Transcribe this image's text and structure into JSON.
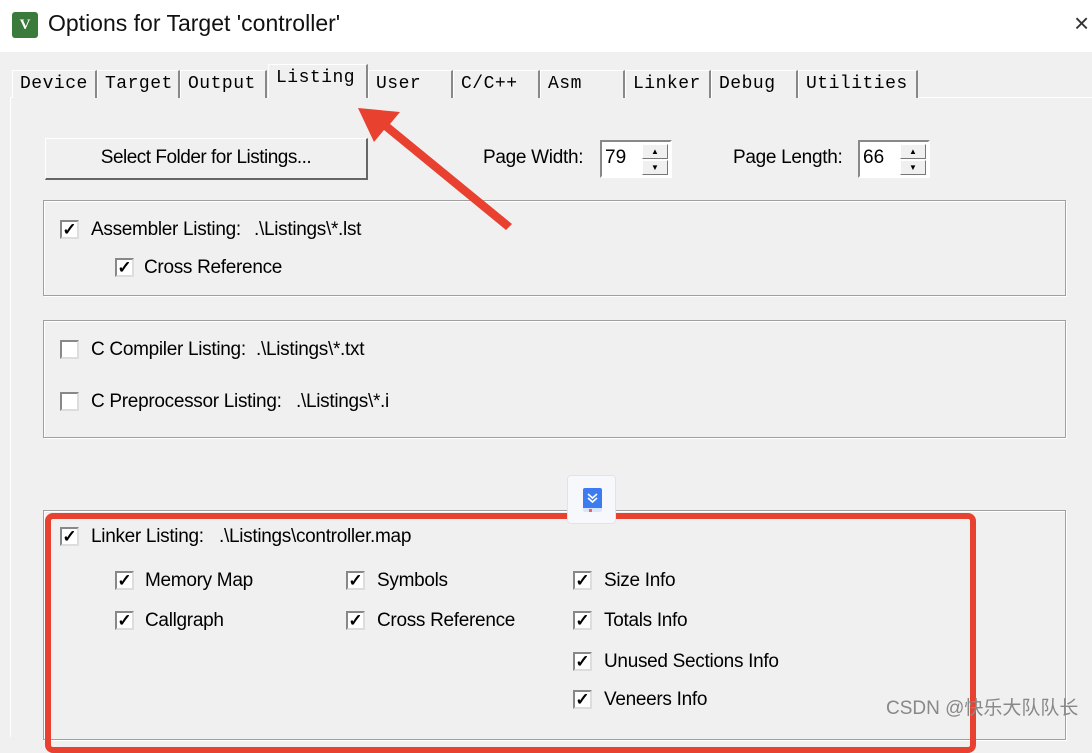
{
  "window": {
    "title": "Options for Target 'controller'",
    "close": "×",
    "icon": "keil-uvision-icon"
  },
  "tabs": [
    {
      "label": "Device"
    },
    {
      "label": "Target"
    },
    {
      "label": "Output"
    },
    {
      "label": "Listing",
      "selected": true
    },
    {
      "label": "User"
    },
    {
      "label": "C/C++"
    },
    {
      "label": "Asm"
    },
    {
      "label": "Linker"
    },
    {
      "label": "Debug"
    },
    {
      "label": "Utilities"
    }
  ],
  "top": {
    "select_folder": "Select Folder for Listings...",
    "page_width_label": "Page Width:",
    "page_width": "79",
    "page_length_label": "Page Length:",
    "page_length": "66"
  },
  "assembler": {
    "label": "Assembler Listing:",
    "path": ".\\Listings\\*.lst",
    "checked": true,
    "cross_ref": "Cross Reference",
    "cross_ref_checked": true
  },
  "compiler": {
    "c_label": "C Compiler Listing:",
    "c_path": ".\\Listings\\*.txt",
    "c_checked": false,
    "pre_label": "C Preprocessor Listing:",
    "pre_path": ".\\Listings\\*.i",
    "pre_checked": false
  },
  "linker": {
    "label": "Linker Listing:",
    "path": ".\\Listings\\controller.map",
    "checked": true,
    "options": [
      {
        "label": "Memory Map",
        "checked": true
      },
      {
        "label": "Symbols",
        "checked": true
      },
      {
        "label": "Size Info",
        "checked": true
      },
      {
        "label": "Callgraph",
        "checked": true
      },
      {
        "label": "Cross Reference",
        "checked": true
      },
      {
        "label": "Totals Info",
        "checked": true
      },
      {
        "label": "Unused Sections Info",
        "checked": true
      },
      {
        "label": "Veneers Info",
        "checked": true
      }
    ]
  },
  "annotation": {
    "color": "#e8412f"
  },
  "watermark": "CSDN @快乐大队队长"
}
